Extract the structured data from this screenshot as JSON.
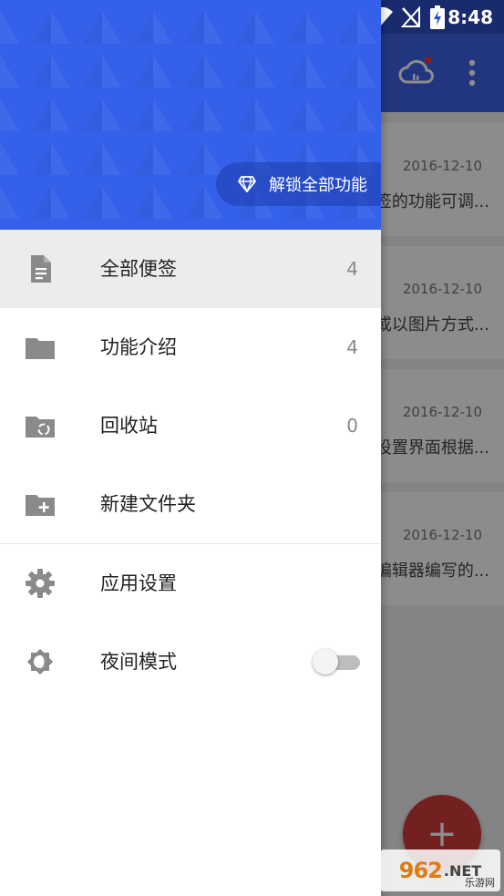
{
  "status_bar": {
    "time": "8:48"
  },
  "background": {
    "cards": [
      {
        "date": "2016-12-10",
        "snippet": "签的功能可调..."
      },
      {
        "date": "2016-12-10",
        "snippet": "或以图片方式..."
      },
      {
        "date": "2016-12-10",
        "snippet": "设置界面根据..."
      },
      {
        "date": "2016-12-10",
        "snippet": "编辑器编写的..."
      }
    ],
    "fab_label": "+"
  },
  "drawer": {
    "unlock_label": "解锁全部功能",
    "items": [
      {
        "label": "全部便签",
        "count": "4",
        "icon": "note-icon"
      },
      {
        "label": "功能介绍",
        "count": "4",
        "icon": "folder-icon"
      },
      {
        "label": "回收站",
        "count": "0",
        "icon": "recycle-folder-icon"
      },
      {
        "label": "新建文件夹",
        "icon": "folder-add-icon"
      },
      {
        "label": "应用设置",
        "icon": "gear-icon"
      },
      {
        "label": "夜间模式",
        "icon": "night-mode-icon"
      }
    ],
    "night_mode_on": false
  },
  "watermark": {
    "main": "962",
    "net": ".NET",
    "sub": "乐游网"
  },
  "colors": {
    "primary": "#3561ea",
    "fab": "#d23b3b",
    "icon_gray": "#8a8a8a"
  }
}
